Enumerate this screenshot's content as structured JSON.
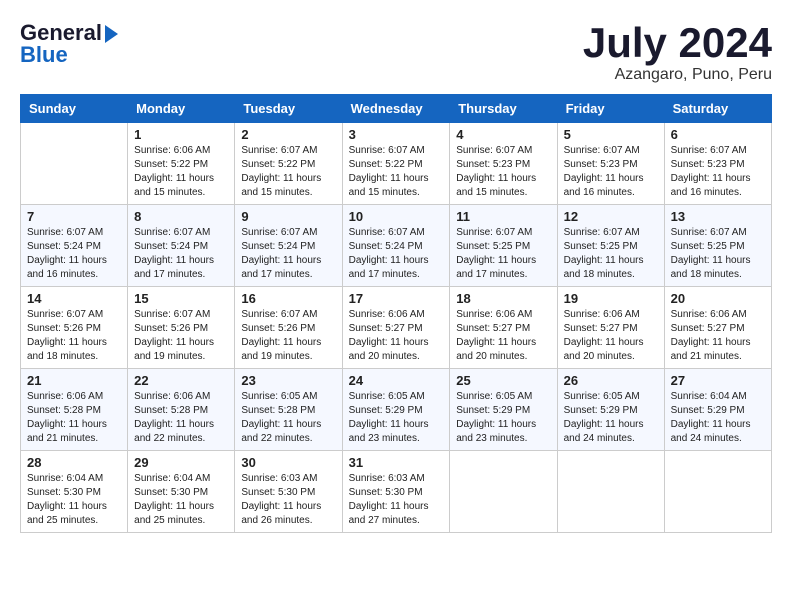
{
  "header": {
    "logo_general": "General",
    "logo_blue": "Blue",
    "month_title": "July 2024",
    "location": "Azangaro, Puno, Peru"
  },
  "calendar": {
    "days_of_week": [
      "Sunday",
      "Monday",
      "Tuesday",
      "Wednesday",
      "Thursday",
      "Friday",
      "Saturday"
    ],
    "weeks": [
      [
        {
          "day": "",
          "info": ""
        },
        {
          "day": "1",
          "info": "Sunrise: 6:06 AM\nSunset: 5:22 PM\nDaylight: 11 hours and 15 minutes."
        },
        {
          "day": "2",
          "info": "Sunrise: 6:07 AM\nSunset: 5:22 PM\nDaylight: 11 hours and 15 minutes."
        },
        {
          "day": "3",
          "info": "Sunrise: 6:07 AM\nSunset: 5:22 PM\nDaylight: 11 hours and 15 minutes."
        },
        {
          "day": "4",
          "info": "Sunrise: 6:07 AM\nSunset: 5:23 PM\nDaylight: 11 hours and 15 minutes."
        },
        {
          "day": "5",
          "info": "Sunrise: 6:07 AM\nSunset: 5:23 PM\nDaylight: 11 hours and 16 minutes."
        },
        {
          "day": "6",
          "info": "Sunrise: 6:07 AM\nSunset: 5:23 PM\nDaylight: 11 hours and 16 minutes."
        }
      ],
      [
        {
          "day": "7",
          "info": "Sunrise: 6:07 AM\nSunset: 5:24 PM\nDaylight: 11 hours and 16 minutes."
        },
        {
          "day": "8",
          "info": "Sunrise: 6:07 AM\nSunset: 5:24 PM\nDaylight: 11 hours and 17 minutes."
        },
        {
          "day": "9",
          "info": "Sunrise: 6:07 AM\nSunset: 5:24 PM\nDaylight: 11 hours and 17 minutes."
        },
        {
          "day": "10",
          "info": "Sunrise: 6:07 AM\nSunset: 5:24 PM\nDaylight: 11 hours and 17 minutes."
        },
        {
          "day": "11",
          "info": "Sunrise: 6:07 AM\nSunset: 5:25 PM\nDaylight: 11 hours and 17 minutes."
        },
        {
          "day": "12",
          "info": "Sunrise: 6:07 AM\nSunset: 5:25 PM\nDaylight: 11 hours and 18 minutes."
        },
        {
          "day": "13",
          "info": "Sunrise: 6:07 AM\nSunset: 5:25 PM\nDaylight: 11 hours and 18 minutes."
        }
      ],
      [
        {
          "day": "14",
          "info": "Sunrise: 6:07 AM\nSunset: 5:26 PM\nDaylight: 11 hours and 18 minutes."
        },
        {
          "day": "15",
          "info": "Sunrise: 6:07 AM\nSunset: 5:26 PM\nDaylight: 11 hours and 19 minutes."
        },
        {
          "day": "16",
          "info": "Sunrise: 6:07 AM\nSunset: 5:26 PM\nDaylight: 11 hours and 19 minutes."
        },
        {
          "day": "17",
          "info": "Sunrise: 6:06 AM\nSunset: 5:27 PM\nDaylight: 11 hours and 20 minutes."
        },
        {
          "day": "18",
          "info": "Sunrise: 6:06 AM\nSunset: 5:27 PM\nDaylight: 11 hours and 20 minutes."
        },
        {
          "day": "19",
          "info": "Sunrise: 6:06 AM\nSunset: 5:27 PM\nDaylight: 11 hours and 20 minutes."
        },
        {
          "day": "20",
          "info": "Sunrise: 6:06 AM\nSunset: 5:27 PM\nDaylight: 11 hours and 21 minutes."
        }
      ],
      [
        {
          "day": "21",
          "info": "Sunrise: 6:06 AM\nSunset: 5:28 PM\nDaylight: 11 hours and 21 minutes."
        },
        {
          "day": "22",
          "info": "Sunrise: 6:06 AM\nSunset: 5:28 PM\nDaylight: 11 hours and 22 minutes."
        },
        {
          "day": "23",
          "info": "Sunrise: 6:05 AM\nSunset: 5:28 PM\nDaylight: 11 hours and 22 minutes."
        },
        {
          "day": "24",
          "info": "Sunrise: 6:05 AM\nSunset: 5:29 PM\nDaylight: 11 hours and 23 minutes."
        },
        {
          "day": "25",
          "info": "Sunrise: 6:05 AM\nSunset: 5:29 PM\nDaylight: 11 hours and 23 minutes."
        },
        {
          "day": "26",
          "info": "Sunrise: 6:05 AM\nSunset: 5:29 PM\nDaylight: 11 hours and 24 minutes."
        },
        {
          "day": "27",
          "info": "Sunrise: 6:04 AM\nSunset: 5:29 PM\nDaylight: 11 hours and 24 minutes."
        }
      ],
      [
        {
          "day": "28",
          "info": "Sunrise: 6:04 AM\nSunset: 5:30 PM\nDaylight: 11 hours and 25 minutes."
        },
        {
          "day": "29",
          "info": "Sunrise: 6:04 AM\nSunset: 5:30 PM\nDaylight: 11 hours and 25 minutes."
        },
        {
          "day": "30",
          "info": "Sunrise: 6:03 AM\nSunset: 5:30 PM\nDaylight: 11 hours and 26 minutes."
        },
        {
          "day": "31",
          "info": "Sunrise: 6:03 AM\nSunset: 5:30 PM\nDaylight: 11 hours and 27 minutes."
        },
        {
          "day": "",
          "info": ""
        },
        {
          "day": "",
          "info": ""
        },
        {
          "day": "",
          "info": ""
        }
      ]
    ]
  }
}
